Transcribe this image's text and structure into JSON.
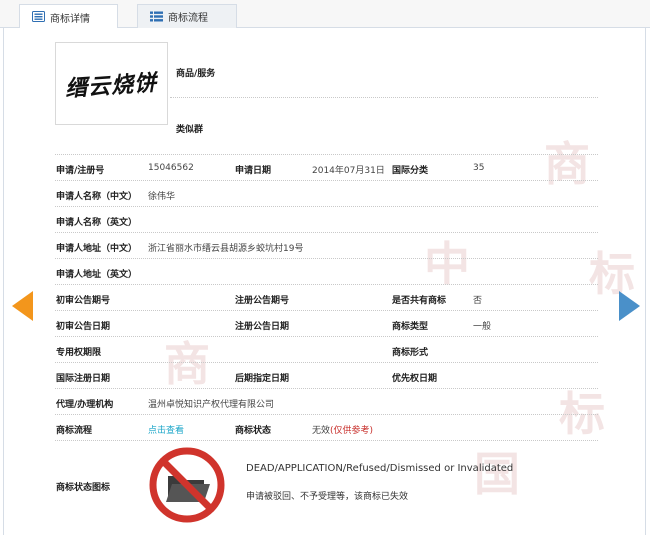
{
  "tabs": [
    {
      "label": "商标详情",
      "icon": "card-list-icon",
      "active": true
    },
    {
      "label": "商标流程",
      "icon": "bullet-list-icon",
      "active": false
    }
  ],
  "watermark": {
    "text": [
      "商",
      "标",
      "中",
      "国",
      "商",
      "标"
    ]
  },
  "logo": {
    "text": "缙云烧饼"
  },
  "fields": {
    "goods_services_label": "商品/服务",
    "similar_group_label": "类似群",
    "app_reg_no_label": "申请/注册号",
    "app_reg_no": "15046562",
    "app_date_label": "申请日期",
    "app_date": "2014年07月31日",
    "intl_class_label": "国际分类",
    "intl_class": "35",
    "applicant_cn_label": "申请人名称（中文）",
    "applicant_cn": "徐伟华",
    "applicant_en_label": "申请人名称（英文）",
    "address_cn_label": "申请人地址（中文）",
    "address_cn": "浙江省丽水市缙云县胡源乡蛟坑村19号",
    "address_en_label": "申请人地址（英文）",
    "prelim_pub_no_label": "初审公告期号",
    "reg_pub_no_label": "注册公告期号",
    "shared_label": "是否共有商标",
    "shared": "否",
    "prelim_pub_date_label": "初审公告日期",
    "reg_pub_date_label": "注册公告日期",
    "mark_type_label": "商标类型",
    "mark_type": "一般",
    "exclusive_period_label": "专用权期限",
    "mark_form_label": "商标形式",
    "intl_reg_date_label": "国际注册日期",
    "later_designation_label": "后期指定日期",
    "priority_date_label": "优先权日期",
    "agency_label": "代理/办理机构",
    "agency": "温州卓悦知识产权代理有限公司",
    "process_label": "商标流程",
    "process_link": "点击查看",
    "status_label": "商标状态",
    "status_value": "无效",
    "status_note": "(仅供参考)",
    "status_icon_label": "商标状态图标",
    "status_en": "DEAD/APPLICATION/Refused/Dismissed or Invalidated",
    "status_cn": "申请被驳回、不予受理等，该商标已失效"
  },
  "colors": {
    "arrow_prev": "#f3961c",
    "arrow_next": "#4a90c9",
    "link": "#1aa5c8",
    "status_note": "#c8302c",
    "no_sign": "#d0342c"
  },
  "nav": {
    "prev_icon": "arrow-left-icon",
    "next_icon": "arrow-right-icon"
  }
}
